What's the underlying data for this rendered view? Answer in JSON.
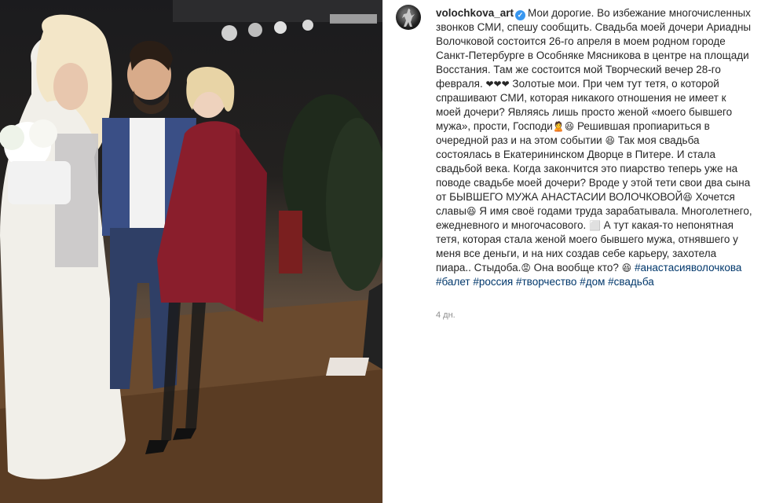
{
  "post": {
    "username": "volochkova_art",
    "caption_parts": [
      "Мои дорогие. Во избежание многочисленных звонков СМИ, спешу сообщить. Свадьба моей дочери Ариадны Волочковой состоится 26-го апреля в моем родном городе Санкт-Петербурге в Особняке Мясникова в центре на площади Восстания. Там же состоится мой Творческий вечер 28-го февраля. ",
      "",
      " Золотые мои. При чем тут тетя, о которой спрашивают СМИ, которая никакого отношения не имеет к моей дочери? Являясь лишь просто женой «моего бывшего мужа», прости, Господи",
      "",
      " Решившая пропиариться в очередной раз и на этом событии ",
      "",
      " Так моя свадьба состоялась в Екатерининском Дворце в Питере. И стала свадьбой века. Когда закончится это пиарство теперь уже на поводе свадьбе моей дочери? Вроде у этой тети свои два сына от БЫВШЕГО МУЖА АНАСТАСИИ ВОЛОЧКОВОЙ",
      " Хочется славы",
      " Я имя своё годами труда зарабатывала. Многолетнего, ежедневного и многочасового. ",
      " А тут какая-то непонятная тетя, которая стала женой моего бывшего мужа, отнявшего у меня все деньги, и на них создав себе карьеру, захотела пиара.. Стыдоба.",
      " Она вообще кто? "
    ],
    "emojis": {
      "hearts": "❤❤❤",
      "person": "🙎",
      "grin": "😆",
      "angry": "😡",
      "box": "⬜"
    },
    "hashtags": [
      "#анастасияволочкова",
      "#балет",
      "#россия",
      "#творчество",
      "#дом",
      "#свадьба"
    ],
    "timestamp": "4 дн."
  }
}
